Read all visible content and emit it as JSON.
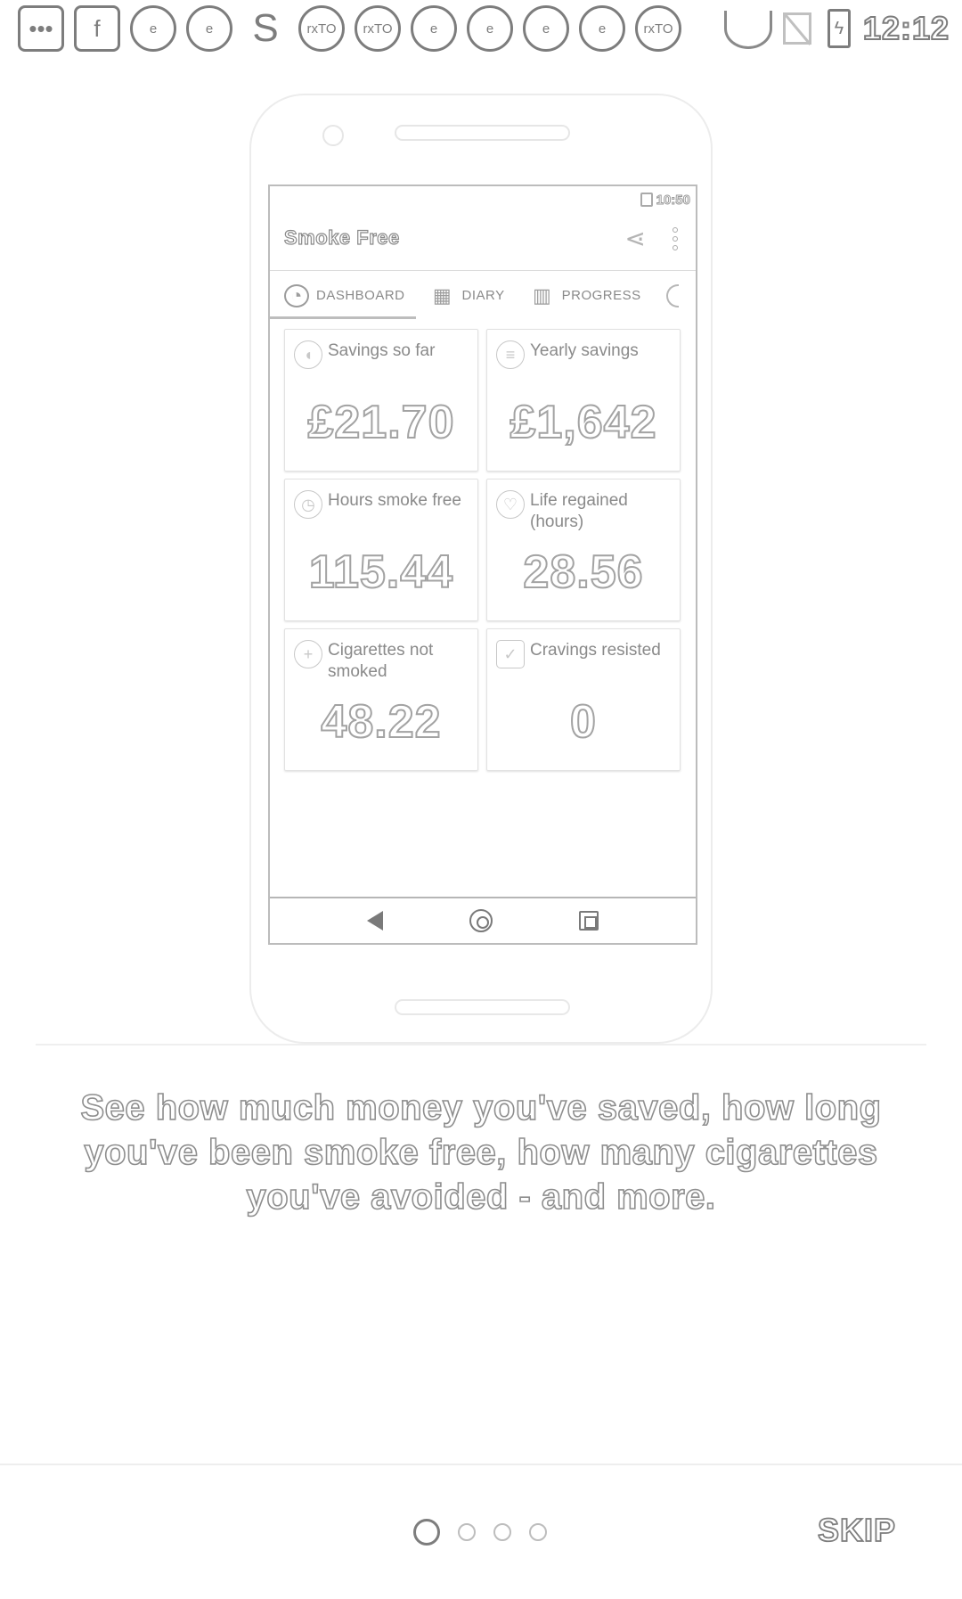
{
  "status_bar": {
    "time": "12:12",
    "icons": [
      "more-dots-icon",
      "facebook-icon",
      "app-e-icon",
      "app-e-icon",
      "app-s-icon",
      "rxto-icon",
      "rxto-icon",
      "app-e-icon",
      "app-e-icon",
      "app-e-icon",
      "app-e-icon",
      "rxto-icon",
      "wifi-icon",
      "no-sim-icon",
      "battery-charging-icon"
    ]
  },
  "mockup": {
    "status_time": "10:50",
    "app_title": "Smoke Free",
    "tabs": [
      {
        "label": "DASHBOARD",
        "icon": "gauge-icon"
      },
      {
        "label": "DIARY",
        "icon": "calendar-icon"
      },
      {
        "label": "PROGRESS",
        "icon": "bar-chart-icon"
      }
    ],
    "cards": [
      {
        "label": "Savings so far",
        "value": "£21.70",
        "icon": "piggy-bank-icon"
      },
      {
        "label": "Yearly savings",
        "value": "£1,642",
        "icon": "coins-icon"
      },
      {
        "label": "Hours smoke free",
        "value": "115.44",
        "icon": "clock-icon"
      },
      {
        "label": "Life regained (hours)",
        "value": "28.56",
        "icon": "heart-pulse-icon"
      },
      {
        "label": "Cigarettes not smoked",
        "value": "48.22",
        "icon": "plus-circle-icon"
      },
      {
        "label": "Cravings resisted",
        "value": "0",
        "icon": "checkbox-icon"
      }
    ]
  },
  "description": "See how much money you've saved, how long you've been smoke free, how many cigarettes you've avoided - and more.",
  "pager": {
    "total": 4,
    "active": 0
  },
  "skip_label": "SKIP",
  "colors": {
    "stroke": "#7d7d7d",
    "background": "#ffffff"
  }
}
